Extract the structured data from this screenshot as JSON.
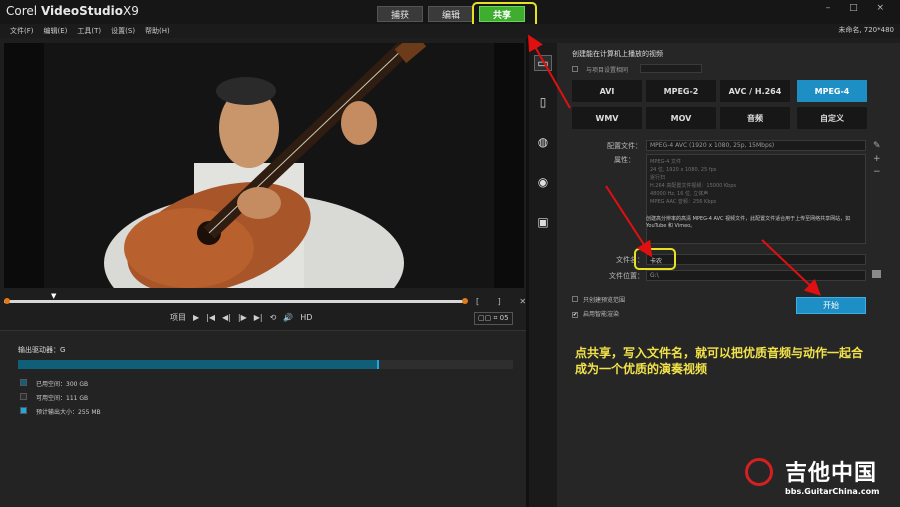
{
  "app": {
    "logo_prefix": "Corel",
    "logo_name": "VideoStudio",
    "logo_version": "X9",
    "window_controls": "– □ ×"
  },
  "top_tabs": [
    {
      "label": "捕获"
    },
    {
      "label": "编辑"
    },
    {
      "label": "共享"
    }
  ],
  "menu": [
    "文件(F)",
    "编辑(E)",
    "工具(T)",
    "设置(S)",
    "帮助(H)"
  ],
  "project_info": "未命名, 720*480",
  "player": {
    "controls": [
      "项目",
      "▶",
      "|◀",
      "◀|",
      "|▶",
      "▶|",
      "⟲",
      "🔊",
      "HD"
    ],
    "timecode": "▢▢ ⌗ 05"
  },
  "output": {
    "drive_label": "输出驱动器：G",
    "drive_used_fraction": 0.73,
    "legend": [
      {
        "label": "已用空间：300 GB",
        "color": "#0f5f78"
      },
      {
        "label": "可用空间：111 GB",
        "color": "#2e2e2e"
      },
      {
        "label": "预计输出大小：255 MB",
        "color": "#1ea8e0"
      }
    ]
  },
  "share": {
    "title": "创建能在计算机上播放的视频",
    "checkbox_label": "与项目设置相同",
    "formats": [
      "AVI",
      "MPEG-2",
      "AVC / H.264",
      "MPEG-4",
      "WMV",
      "MOV",
      "音频",
      "自定义"
    ],
    "active_format": "MPEG-4",
    "profile_label": "配置文件：",
    "profile_value": "MPEG-4 AVC (1920 x 1080, 25p, 15Mbps)",
    "attr_label": "属性：",
    "attributes": [
      "MPEG-4 文件",
      "24 位, 1920 x 1080, 25 fps",
      "逐行扫",
      "H.264 高配置文件视频：15000 Kbps",
      "48000 Hz, 16 位, 立体声",
      "MPEG AAC 音频：256 Kbps"
    ],
    "description": "创建高分辨率的高清 MPEG-4 AVC 视频文件，此配置文件适合用于上传至网络共享网站，如 YouTube 和 Vimeo。",
    "filename_label": "文件名：",
    "filename_value": "卡农",
    "location_label": "文件位置：",
    "location_value": "G:\\",
    "option_1": "只创建预览范围",
    "option_2": "启用智能渲染",
    "start_label": "开始"
  },
  "annotation": {
    "caption": "点共享，写入文件名，就可以把优质音频与动作一起合成为一个优质的演奏视频",
    "accent": "#e8e022",
    "arrow_color": "#e01010"
  },
  "watermark": {
    "main": "吉他中国",
    "sub": "bbs.GuitarChina.com"
  }
}
